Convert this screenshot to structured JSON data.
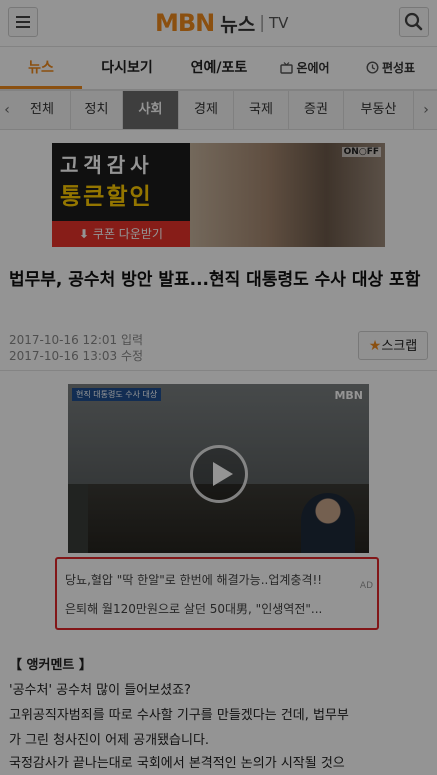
{
  "header": {
    "logo_mbn": "MBN",
    "logo_news": "뉴스",
    "logo_sep": "|",
    "logo_tv": "TV"
  },
  "main_nav": {
    "items": [
      "뉴스",
      "다시보기",
      "연예/포토"
    ],
    "onair": "온에어",
    "schedule": "편성표"
  },
  "sub_nav": {
    "items": [
      "전체",
      "정치",
      "사회",
      "경제",
      "국제",
      "증권",
      "부동산"
    ],
    "active": "사회"
  },
  "banner_ad": {
    "line1": "고객감사",
    "line2": "통큰할인",
    "coupon": "쿠폰 다운받기",
    "brand": "ON○FF"
  },
  "article": {
    "title": "법무부, 공수처 방안 발표...현직 대통령도 수사 대상 포함",
    "input_date": "2017-10-16 12:01 입력",
    "edit_date": "2017-10-16 13:03 수정",
    "scrap_label": "스크랩"
  },
  "video": {
    "caption": "현직 대통령도 수사 대상",
    "logo": "MBN"
  },
  "text_ad": {
    "line1": "당뇨,혈압 \"딱 한알\"로 한번에 해결가능..업계충격!!",
    "line2": "은퇴해 월120만원으로 살던 50대男, \"인생역전\"...",
    "tag": "AD"
  },
  "body_lines": [
    "【 앵커멘트 】",
    "'공수처' 공수처 많이 들어보셨죠?",
    "고위공직자범죄를 따로 수사할 기구를 만들겠다는 건데, 법무부",
    "가 그린 청사진이 어제 공개됐습니다.",
    "국정감사가 끝나는대로 국회에서 본격적인 논의가 시작될 것으"
  ],
  "colors": {
    "accent": "#f08a1c",
    "ad_red": "#e0262a",
    "dim_overlay": "rgba(0,0,0,0.42)"
  }
}
